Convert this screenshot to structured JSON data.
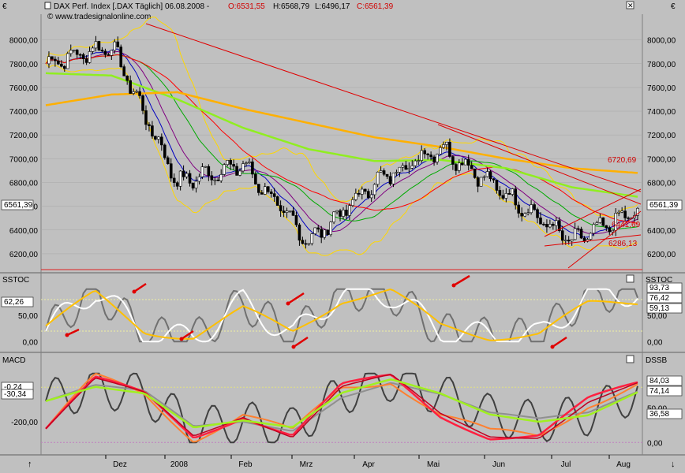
{
  "header": {
    "currency_left": "€",
    "currency_right": "€",
    "instrument": "DAX Perf. Index [.DAX  Täglich] 06.08.2008 -",
    "open": "O:6531,55",
    "high": "H:6568,79",
    "low": "L:6496,17",
    "close": "C:6561,39",
    "watermark": "© www.tradesignalonline.com"
  },
  "colors": {
    "background": "#c0c0c0",
    "price": "#000000",
    "bollinger": "#ffd700",
    "ma_green": "#00aa00",
    "ma_purple": "#800080",
    "ma_blue": "#0000c0",
    "ma_red": "#ff0000",
    "ma_lightgreen": "#90ee20",
    "ma_orange": "#ffb000",
    "trendline": "#e00000",
    "sstoc_white": "#ffffff",
    "sstoc_gray": "#707070",
    "sstoc_yellow": "#ffc000",
    "arrow": "#e00000"
  },
  "x_axis": {
    "labels": [
      "Dez",
      "2008",
      "Feb",
      "Mrz",
      "Apr",
      "Mai",
      "Jun",
      "Jul",
      "Aug"
    ],
    "range": [
      "2007-11-01",
      "2008-08-06"
    ]
  },
  "main_panel": {
    "y_ticks": [
      "8000,00",
      "7800,00",
      "7600,00",
      "7400,00",
      "7200,00",
      "7000,00",
      "6800,00",
      "6600,00",
      "6400,00",
      "6200,00"
    ],
    "ylim": [
      6080,
      8150
    ],
    "current_badge": "6561,39",
    "annotations": [
      "6720,69",
      "6441,69",
      "6286,13"
    ]
  },
  "sstoc_panel": {
    "title": "SSTOC",
    "title_right": "SSTOC",
    "left_badge": "62,26",
    "y_ticks_left": [
      "50,00",
      "0,00"
    ],
    "y_ticks_right": [
      "50,00",
      "0,00"
    ],
    "badges_right": [
      "93,73",
      "76,42",
      "59,13"
    ],
    "ylim": [
      -10,
      110
    ]
  },
  "macd_panel": {
    "title": "MACD",
    "title_right": "DSSB",
    "left_badges": [
      "-0,24",
      "-30,34"
    ],
    "y_ticks_left": [
      "-200,00"
    ],
    "y_ticks_right": [
      "50,00",
      "0,00"
    ],
    "badges_right": [
      "84,03",
      "74,14",
      "36,58"
    ],
    "ylim": [
      -10,
      110
    ]
  },
  "chart_data": [
    {
      "type": "candlestick",
      "title": "DAX Perf. Index [.DAX  Täglich] 06.08.2008",
      "x": [
        "2007-11",
        "2007-12",
        "2008-01",
        "2008-02",
        "2008-03",
        "2008-04",
        "2008-05",
        "2008-06",
        "2008-07",
        "2008-08-06"
      ],
      "series": [
        {
          "name": "close",
          "values": [
            7800,
            7950,
            6800,
            6950,
            6300,
            6800,
            7100,
            6700,
            6300,
            6561
          ]
        },
        {
          "name": "",
          "values": [
            7450,
            7540,
            7560,
            7420,
            7300,
            7180,
            7100,
            7000,
            6920,
            6880
          ]
        },
        {
          "name": "",
          "values": [
            7720,
            7700,
            7500,
            7260,
            7080,
            6980,
            6990,
            6920,
            6760,
            6680
          ]
        }
      ],
      "ylim": [
        6080,
        8150
      ]
    },
    {
      "type": "line",
      "title": "SSTOC",
      "series": [
        {
          "name": "",
          "values": [
            30,
            90,
            20,
            10,
            60,
            20,
            80,
            95,
            30,
            10,
            15,
            70,
            76
          ]
        },
        {
          "name": "",
          "values": [
            20,
            100,
            15,
            5,
            75,
            10,
            95,
            90,
            20,
            10,
            10,
            90,
            93
          ]
        }
      ],
      "ylim": [
        -10,
        110
      ]
    },
    {
      "type": "line",
      "title": "MACD",
      "series": [
        {
          "name": "",
          "values": [
            20,
            90,
            70,
            10,
            40,
            10,
            80,
            95,
            40,
            10,
            10,
            60,
            84
          ]
        },
        {
          "name": "",
          "values": [
            60,
            80,
            70,
            20,
            30,
            20,
            70,
            90,
            70,
            40,
            30,
            40,
            74
          ]
        }
      ],
      "ylim": [
        -10,
        110
      ]
    }
  ]
}
